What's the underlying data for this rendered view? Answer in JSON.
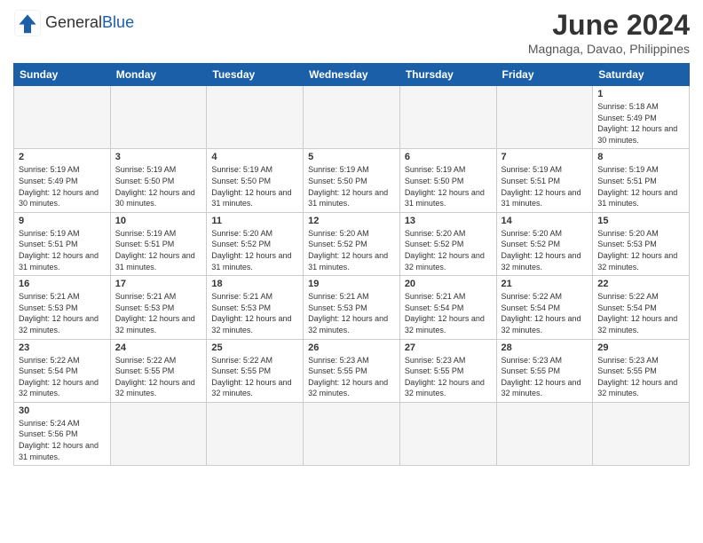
{
  "header": {
    "logo_general": "General",
    "logo_blue": "Blue",
    "title": "June 2024",
    "subtitle": "Magnaga, Davao, Philippines"
  },
  "weekdays": [
    "Sunday",
    "Monday",
    "Tuesday",
    "Wednesday",
    "Thursday",
    "Friday",
    "Saturday"
  ],
  "weeks": [
    [
      {
        "day": "",
        "empty": true
      },
      {
        "day": "",
        "empty": true
      },
      {
        "day": "",
        "empty": true
      },
      {
        "day": "",
        "empty": true
      },
      {
        "day": "",
        "empty": true
      },
      {
        "day": "",
        "empty": true
      },
      {
        "day": "1",
        "sunrise": "5:18 AM",
        "sunset": "5:49 PM",
        "daylight": "12 hours and 30 minutes."
      }
    ],
    [
      {
        "day": "2",
        "sunrise": "5:19 AM",
        "sunset": "5:49 PM",
        "daylight": "12 hours and 30 minutes."
      },
      {
        "day": "3",
        "sunrise": "5:19 AM",
        "sunset": "5:50 PM",
        "daylight": "12 hours and 30 minutes."
      },
      {
        "day": "4",
        "sunrise": "5:19 AM",
        "sunset": "5:50 PM",
        "daylight": "12 hours and 31 minutes."
      },
      {
        "day": "5",
        "sunrise": "5:19 AM",
        "sunset": "5:50 PM",
        "daylight": "12 hours and 31 minutes."
      },
      {
        "day": "6",
        "sunrise": "5:19 AM",
        "sunset": "5:50 PM",
        "daylight": "12 hours and 31 minutes."
      },
      {
        "day": "7",
        "sunrise": "5:19 AM",
        "sunset": "5:51 PM",
        "daylight": "12 hours and 31 minutes."
      },
      {
        "day": "8",
        "sunrise": "5:19 AM",
        "sunset": "5:51 PM",
        "daylight": "12 hours and 31 minutes."
      }
    ],
    [
      {
        "day": "9",
        "sunrise": "5:19 AM",
        "sunset": "5:51 PM",
        "daylight": "12 hours and 31 minutes."
      },
      {
        "day": "10",
        "sunrise": "5:19 AM",
        "sunset": "5:51 PM",
        "daylight": "12 hours and 31 minutes."
      },
      {
        "day": "11",
        "sunrise": "5:20 AM",
        "sunset": "5:52 PM",
        "daylight": "12 hours and 31 minutes."
      },
      {
        "day": "12",
        "sunrise": "5:20 AM",
        "sunset": "5:52 PM",
        "daylight": "12 hours and 31 minutes."
      },
      {
        "day": "13",
        "sunrise": "5:20 AM",
        "sunset": "5:52 PM",
        "daylight": "12 hours and 32 minutes."
      },
      {
        "day": "14",
        "sunrise": "5:20 AM",
        "sunset": "5:52 PM",
        "daylight": "12 hours and 32 minutes."
      },
      {
        "day": "15",
        "sunrise": "5:20 AM",
        "sunset": "5:53 PM",
        "daylight": "12 hours and 32 minutes."
      }
    ],
    [
      {
        "day": "16",
        "sunrise": "5:21 AM",
        "sunset": "5:53 PM",
        "daylight": "12 hours and 32 minutes."
      },
      {
        "day": "17",
        "sunrise": "5:21 AM",
        "sunset": "5:53 PM",
        "daylight": "12 hours and 32 minutes."
      },
      {
        "day": "18",
        "sunrise": "5:21 AM",
        "sunset": "5:53 PM",
        "daylight": "12 hours and 32 minutes."
      },
      {
        "day": "19",
        "sunrise": "5:21 AM",
        "sunset": "5:53 PM",
        "daylight": "12 hours and 32 minutes."
      },
      {
        "day": "20",
        "sunrise": "5:21 AM",
        "sunset": "5:54 PM",
        "daylight": "12 hours and 32 minutes."
      },
      {
        "day": "21",
        "sunrise": "5:22 AM",
        "sunset": "5:54 PM",
        "daylight": "12 hours and 32 minutes."
      },
      {
        "day": "22",
        "sunrise": "5:22 AM",
        "sunset": "5:54 PM",
        "daylight": "12 hours and 32 minutes."
      }
    ],
    [
      {
        "day": "23",
        "sunrise": "5:22 AM",
        "sunset": "5:54 PM",
        "daylight": "12 hours and 32 minutes."
      },
      {
        "day": "24",
        "sunrise": "5:22 AM",
        "sunset": "5:55 PM",
        "daylight": "12 hours and 32 minutes."
      },
      {
        "day": "25",
        "sunrise": "5:22 AM",
        "sunset": "5:55 PM",
        "daylight": "12 hours and 32 minutes."
      },
      {
        "day": "26",
        "sunrise": "5:23 AM",
        "sunset": "5:55 PM",
        "daylight": "12 hours and 32 minutes."
      },
      {
        "day": "27",
        "sunrise": "5:23 AM",
        "sunset": "5:55 PM",
        "daylight": "12 hours and 32 minutes."
      },
      {
        "day": "28",
        "sunrise": "5:23 AM",
        "sunset": "5:55 PM",
        "daylight": "12 hours and 32 minutes."
      },
      {
        "day": "29",
        "sunrise": "5:23 AM",
        "sunset": "5:55 PM",
        "daylight": "12 hours and 32 minutes."
      }
    ],
    [
      {
        "day": "30",
        "sunrise": "5:24 AM",
        "sunset": "5:56 PM",
        "daylight": "12 hours and 31 minutes."
      },
      {
        "day": "",
        "empty": true
      },
      {
        "day": "",
        "empty": true
      },
      {
        "day": "",
        "empty": true
      },
      {
        "day": "",
        "empty": true
      },
      {
        "day": "",
        "empty": true
      },
      {
        "day": "",
        "empty": true
      }
    ]
  ]
}
